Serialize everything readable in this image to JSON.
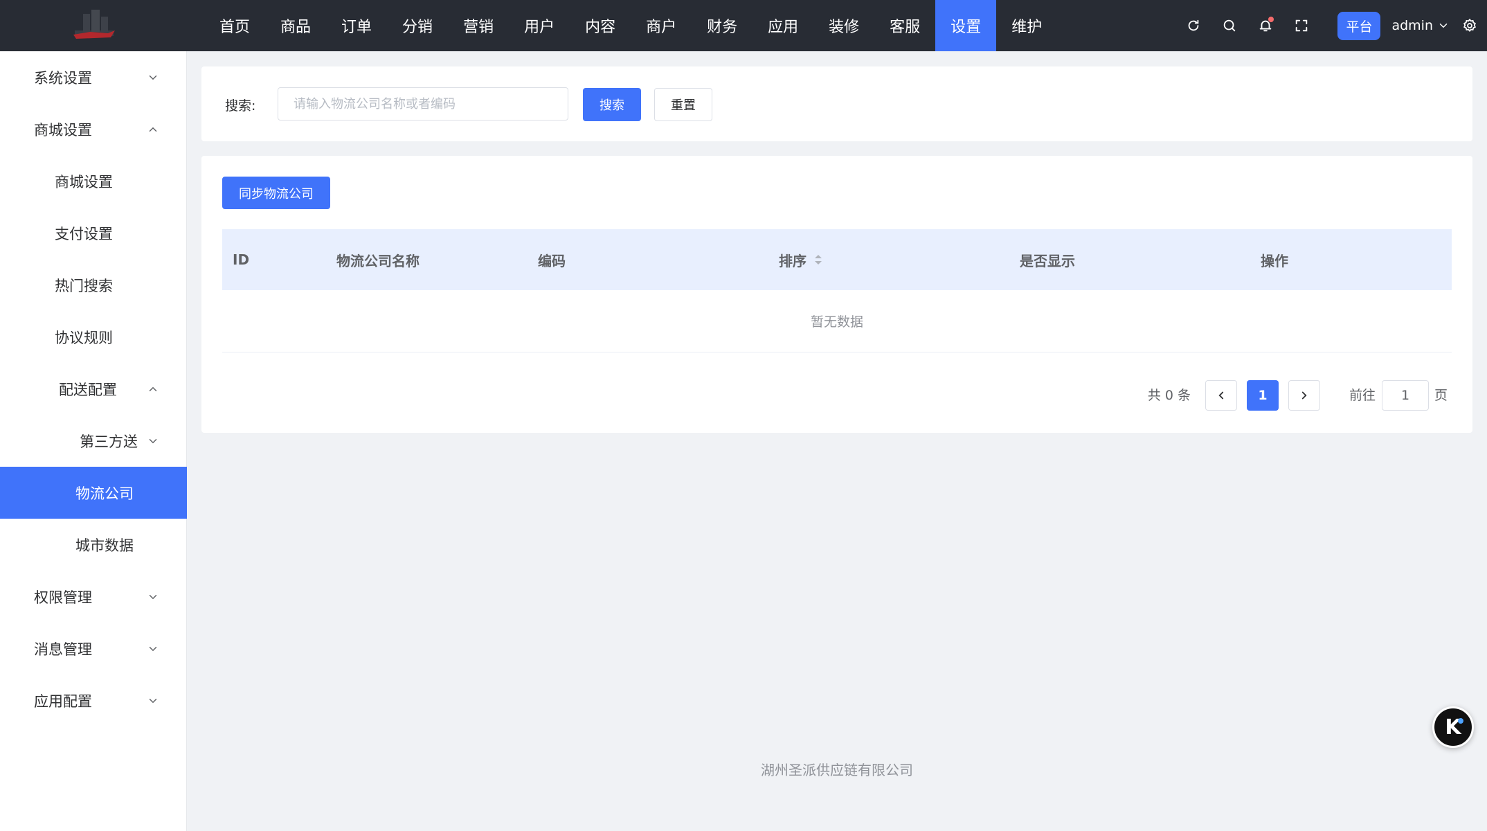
{
  "topnav": {
    "items": [
      "首页",
      "商品",
      "订单",
      "分销",
      "营销",
      "用户",
      "内容",
      "商户",
      "财务",
      "应用",
      "装修",
      "客服",
      "设置",
      "维护"
    ],
    "active": "设置"
  },
  "header": {
    "platform_badge": "平台",
    "user": "admin"
  },
  "sidebar": {
    "items": [
      {
        "label": "系统设置"
      },
      {
        "label": "商城设置"
      },
      {
        "label": "商城设置"
      },
      {
        "label": "支付设置"
      },
      {
        "label": "热门搜索"
      },
      {
        "label": "协议规则"
      },
      {
        "label": "配送配置"
      },
      {
        "label": "第三方送"
      },
      {
        "label": "物流公司"
      },
      {
        "label": "城市数据"
      },
      {
        "label": "权限管理"
      },
      {
        "label": "消息管理"
      },
      {
        "label": "应用配置"
      }
    ],
    "active": "物流公司"
  },
  "search": {
    "label": "搜索:",
    "placeholder": "请输入物流公司名称或者编码",
    "search_button": "搜索",
    "reset_button": "重置"
  },
  "table": {
    "sync_button": "同步物流公司",
    "columns": [
      "ID",
      "物流公司名称",
      "编码",
      "排序",
      "是否显示",
      "操作"
    ],
    "empty_text": "暂无数据"
  },
  "pagination": {
    "total": "共 0 条",
    "current_page": "1",
    "goto_label": "前往",
    "goto_value": "1",
    "page_suffix": "页"
  },
  "footer": {
    "company": "湖州圣派供应链有限公司"
  },
  "colors": {
    "primary": "#4073fa",
    "topbar": "#282c34",
    "table_header": "#e8effe"
  }
}
